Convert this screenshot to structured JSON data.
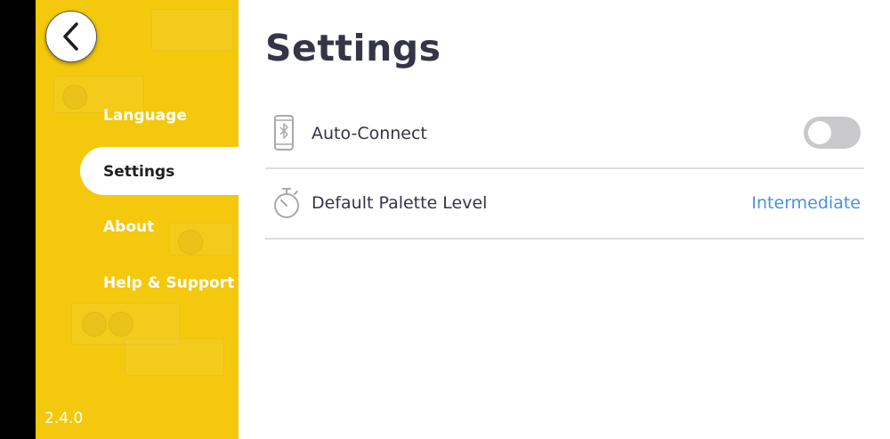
{
  "sidebar": {
    "back_icon": "chevron-left-icon",
    "items": [
      {
        "label": "Language"
      },
      {
        "label": "Settings"
      },
      {
        "label": "About"
      },
      {
        "label": "Help & Support"
      }
    ],
    "active_item": "Settings",
    "version": "2.4.0",
    "background_color": "#f3c80d"
  },
  "main": {
    "title": "Settings",
    "rows": [
      {
        "icon": "bluetooth-phone-icon",
        "label": "Auto-Connect",
        "control": "toggle",
        "toggle_on": false
      },
      {
        "icon": "stopwatch-icon",
        "label": "Default Palette Level",
        "value": "Intermediate"
      }
    ],
    "accent_color": "#4a90e2"
  }
}
